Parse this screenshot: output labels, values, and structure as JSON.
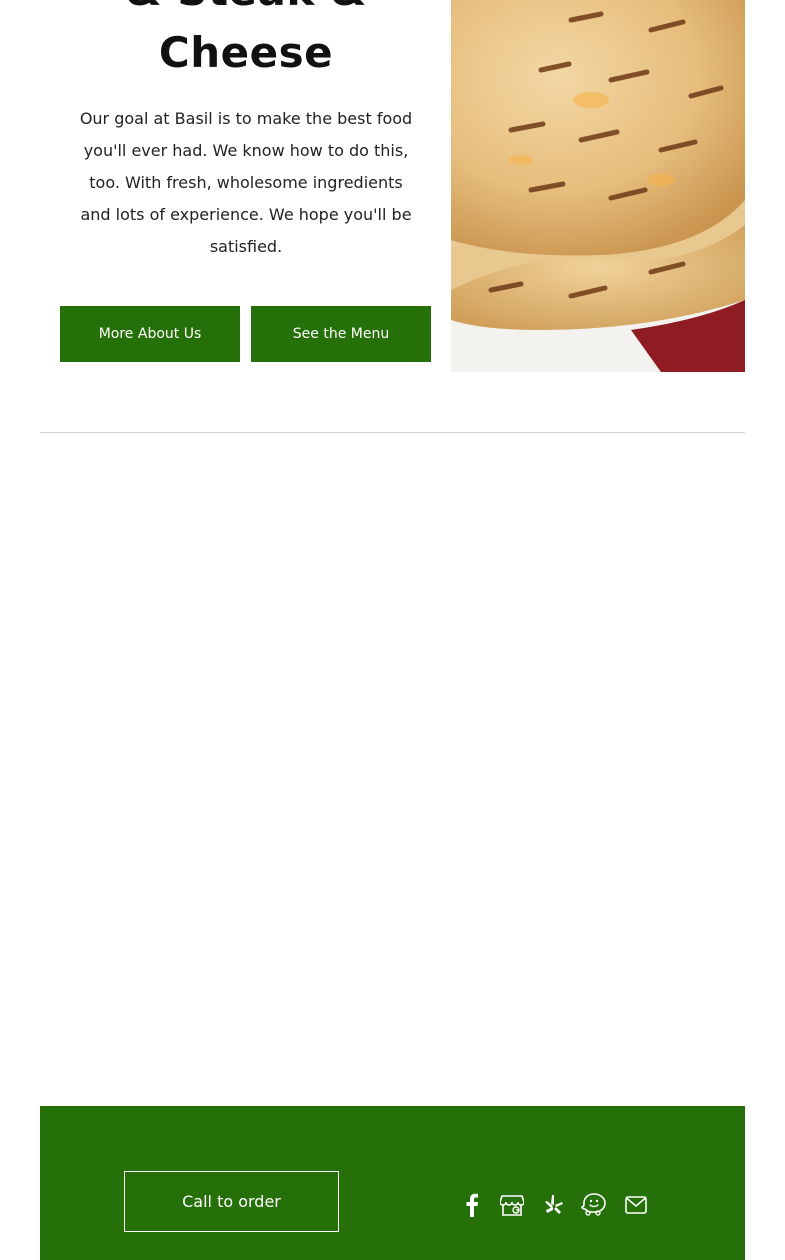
{
  "hero": {
    "title_line1": "& Steak &",
    "title_line2": "Cheese",
    "description": "Our goal at Basil is to make the best food you'll ever had. We know how to do this, too. With fresh, wholesome ingredients and lots of experience. We hope you'll be satisfied."
  },
  "buttons": {
    "about": "More About Us",
    "menu": "See the Menu"
  },
  "footer": {
    "call_label": "Call to order",
    "social_icons": [
      "facebook-icon",
      "google-business-icon",
      "yelp-icon",
      "waze-icon",
      "email-icon"
    ]
  },
  "colors": {
    "brand_green": "#26700a",
    "divider": "#cfcfcf"
  }
}
